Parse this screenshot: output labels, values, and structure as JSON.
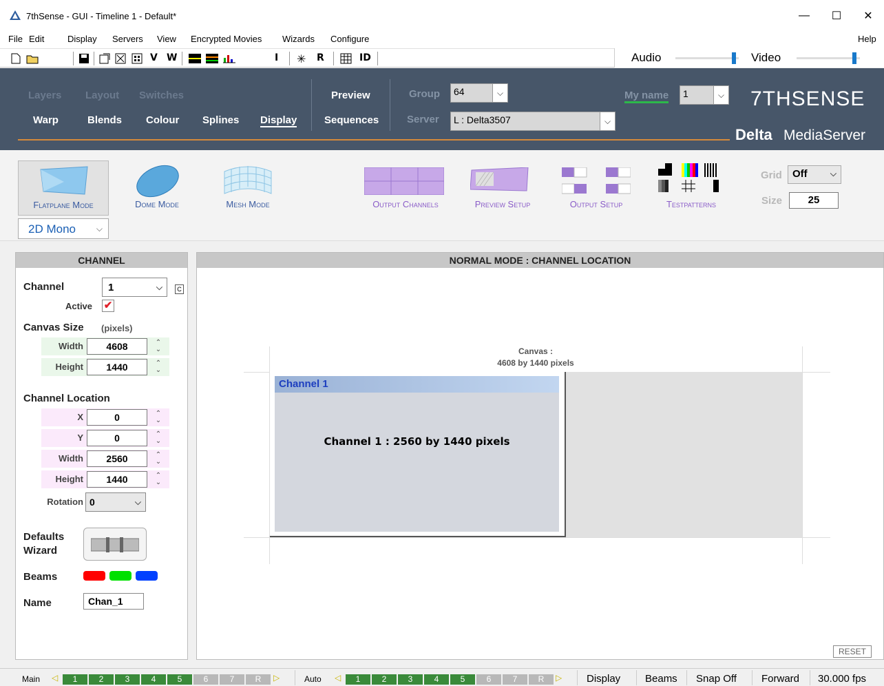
{
  "window": {
    "title": "7thSense -  GUI  - Timeline 1  - Default*",
    "minimize": "—",
    "maximize": "☐",
    "close": "✕"
  },
  "menu": {
    "file": "File",
    "edit": "Edit",
    "display": "Display",
    "servers": "Servers",
    "view": "View",
    "encrypted": "Encrypted Movies",
    "wizards": "Wizards",
    "configure": "Configure",
    "help": "Help"
  },
  "toolbar": {
    "v": "V",
    "w": "W",
    "i": "I",
    "r": "R",
    "id": "ID"
  },
  "av": {
    "audio": "Audio",
    "video": "Video",
    "audio_level": 0.95,
    "video_level": 0.95
  },
  "header": {
    "layers": "Layers",
    "layout": "Layout",
    "switches": "Switches",
    "warp": "Warp",
    "blends": "Blends",
    "colour": "Colour",
    "splines": "Splines",
    "display": "Display",
    "preview": "Preview",
    "sequences": "Sequences",
    "group_label": "Group",
    "group_value": "64",
    "server_label": "Server",
    "server_value": "L : Delta3507",
    "myname_label": "My name",
    "myname_value": "1",
    "brand": "7THSENSE",
    "product_bold": "Delta",
    "product_rest": "MediaServer"
  },
  "modes": {
    "flatplane": "Flatplane Mode",
    "dome": "Dome Mode",
    "mesh": "Mesh Mode",
    "output_channels": "Output Channels",
    "preview_setup": "Preview Setup",
    "output_setup": "Output Setup",
    "testpatterns": "Testpatterns",
    "grid_label": "Grid",
    "grid_value": "Off",
    "size_label": "Size",
    "size_value": "25",
    "stereo_value": "2D Mono"
  },
  "channel": {
    "title": "CHANNEL",
    "channel_label": "Channel",
    "channel_value": "1",
    "c_button": "C",
    "active_label": "Active",
    "canvas_size_label": "Canvas Size",
    "pixels_label": "(pixels)",
    "width_label": "Width",
    "canvas_width": "4608",
    "height_label": "Height",
    "canvas_height": "1440",
    "location_label": "Channel Location",
    "x_label": "X",
    "x_value": "0",
    "y_label": "Y",
    "y_value": "0",
    "loc_width": "2560",
    "loc_height": "1440",
    "rotation_label": "Rotation",
    "rotation_value": "0",
    "defaults_label": "Defaults",
    "wizard_label": "Wizard",
    "beams_label": "Beams",
    "beam_colors": [
      "#ff0000",
      "#00e000",
      "#0040ff"
    ],
    "name_label": "Name",
    "name_value": "Chan_1"
  },
  "canvas": {
    "title": "NORMAL MODE : CHANNEL LOCATION",
    "canvas_caption_1": "Canvas :",
    "canvas_caption_2": "4608 by 1440 pixels",
    "channel_title": "Channel 1",
    "channel_text": "Channel 1 : 2560 by 1440 pixels",
    "reset": "RESET"
  },
  "status": {
    "main": "Main",
    "auto": "Auto",
    "main_nums": [
      "1",
      "2",
      "3",
      "4",
      "5",
      "6",
      "7",
      "R"
    ],
    "auto_nums": [
      "1",
      "2",
      "3",
      "4",
      "5",
      "6",
      "7",
      "R"
    ],
    "display": "Display",
    "beams": "Beams",
    "snap": "Snap Off",
    "forward": "Forward",
    "fps": "30.000 fps"
  }
}
